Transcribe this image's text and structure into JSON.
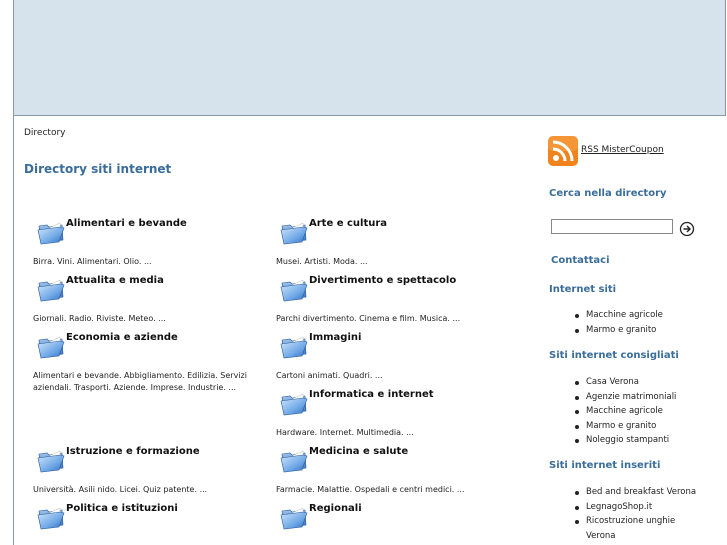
{
  "breadcrumb": "Directory",
  "page_title": "Directory siti internet",
  "categories": [
    {
      "title": "Alimentari e bevande",
      "desc": "Birra. Vini. Alimentari. Olio. ..."
    },
    {
      "title": "Arte e cultura",
      "desc": "Musei. Artisti. Moda. ..."
    },
    {
      "title": "Attualita e media",
      "desc": "Giornali. Radio. Riviste. Meteo. ..."
    },
    {
      "title": "Divertimento e spettacolo",
      "desc": "Parchi divertimento. Cinema e film. Musica. ..."
    },
    {
      "title": "Economia e aziende",
      "desc": "Alimentari e bevande. Abbigliamento. Edilizia. Servizi aziendali. Trasporti. Aziende. Imprese. Industrie. ..."
    },
    {
      "title": "Immagini",
      "desc": "Cartoni animati. Quadri. ..."
    },
    {
      "title": "Informatica e internet",
      "desc": "Hardware. Internet. Multimedia. ..."
    },
    {
      "title": "Istruzione e formazione",
      "desc": "Università. Asili nido. Licei. Quiz patente. ..."
    },
    {
      "title": "Medicina e salute",
      "desc": "Farmacie. Malattie. Ospedali e centri medici. ..."
    },
    {
      "title": "Politica e istituzioni",
      "desc": ""
    },
    {
      "title": "Regionali",
      "desc": ""
    }
  ],
  "sidebar": {
    "rss_label": "RSS MisterCoupon",
    "search_heading": "Cerca nella directory",
    "contact": "Contattaci",
    "internet_sites": {
      "heading": "Internet siti",
      "items": [
        "Macchine agricole",
        "Marmo e granito"
      ]
    },
    "recommended": {
      "heading": "Siti internet consigliati",
      "items": [
        "Casa Verona",
        "Agenzie matrimoniali",
        "Macchine agricole",
        "Marmo e granito",
        "Noleggio stampanti"
      ]
    },
    "inserted": {
      "heading": "Siti internet inseriti",
      "items": [
        "Bed and breakfast Verona",
        "LegnagoShop.it",
        "Ricostruzione unghie Verona"
      ]
    }
  },
  "colors": {
    "header_bg": "#d6e2ec",
    "heading_blue": "#3a6d9a",
    "rss_orange": "#f0831c"
  }
}
